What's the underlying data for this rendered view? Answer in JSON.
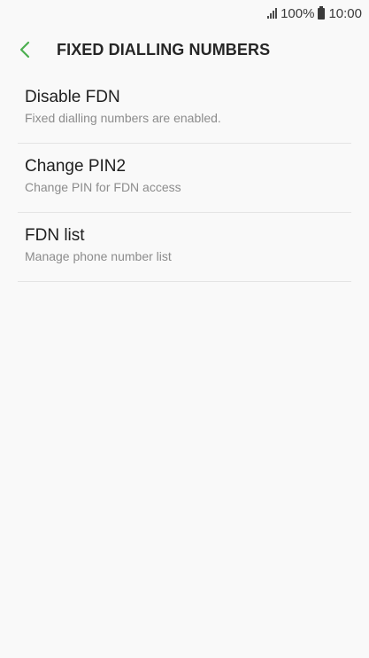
{
  "status_bar": {
    "battery": "100%",
    "time": "10:00",
    "icons": [
      "signal-icon",
      "battery-icon"
    ]
  },
  "header": {
    "title": "FIXED DIALLING NUMBERS",
    "back_icon": "chevron-left-icon",
    "accent_color": "#4caf50"
  },
  "items": [
    {
      "title": "Disable FDN",
      "subtitle": "Fixed dialling numbers are enabled."
    },
    {
      "title": "Change PIN2",
      "subtitle": "Change PIN for FDN access"
    },
    {
      "title": "FDN list",
      "subtitle": "Manage phone number list"
    }
  ]
}
